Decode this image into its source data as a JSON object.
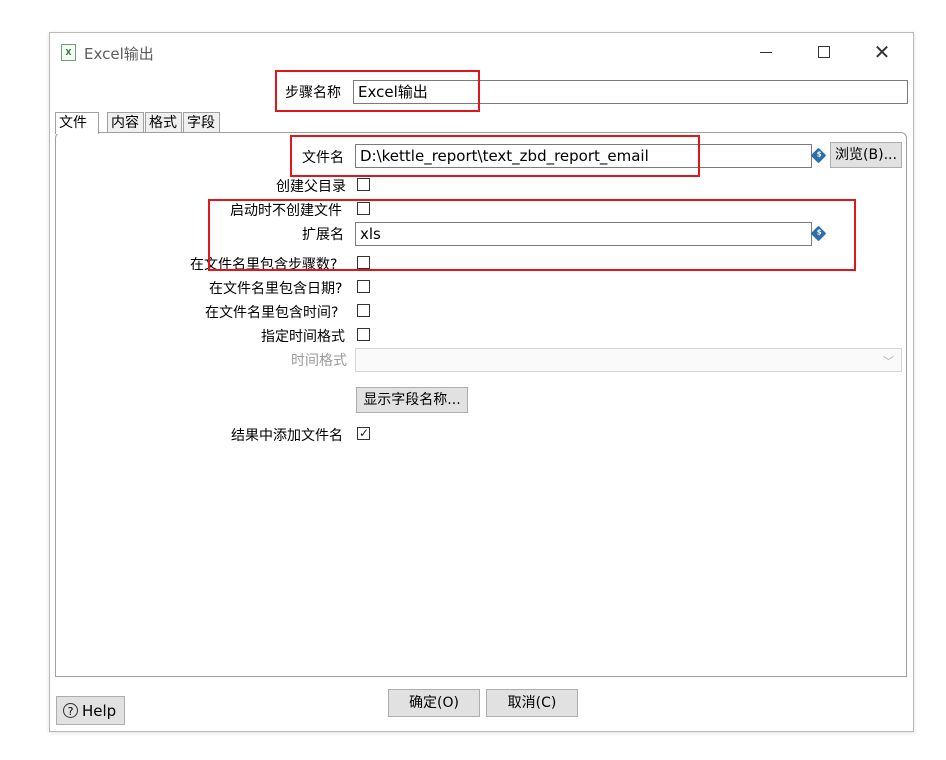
{
  "window": {
    "title": "Excel输出",
    "title_icon": "excel-file-icon"
  },
  "step_name": {
    "label": "步骤名称",
    "value": "Excel输出"
  },
  "tabs": [
    {
      "label": "文件",
      "active": true
    },
    {
      "label": "内容",
      "active": false
    },
    {
      "label": "格式",
      "active": false
    },
    {
      "label": "字段",
      "active": false
    }
  ],
  "file": {
    "filename_label": "文件名",
    "filename_value": "D:\\kettle_report\\text_zbd_report_email",
    "browse_label": "浏览(B)...",
    "create_parent_label": "创建父目录",
    "create_parent_checked": false,
    "no_create_on_start_label": "启动时不创建文件",
    "no_create_on_start_checked": false,
    "extension_label": "扩展名",
    "extension_value": "xls",
    "include_stepnr_label": "在文件名里包含步骤数?",
    "include_stepnr_checked": false,
    "include_date_label": "在文件名里包含日期?",
    "include_date_checked": false,
    "include_time_label": "在文件名里包含时间?",
    "include_time_checked": false,
    "specify_format_label": "指定时间格式",
    "specify_format_checked": false,
    "date_format_label": "时间格式",
    "date_format_value": "",
    "show_fields_label": "显示字段名称...",
    "add_to_result_label": "结果中添加文件名",
    "add_to_result_checked": true
  },
  "footer": {
    "ok_label": "确定(O)",
    "cancel_label": "取消(C)",
    "help_label": "Help"
  },
  "colors": {
    "highlight": "#e0161c",
    "variable_icon": "#2d6fa8"
  }
}
